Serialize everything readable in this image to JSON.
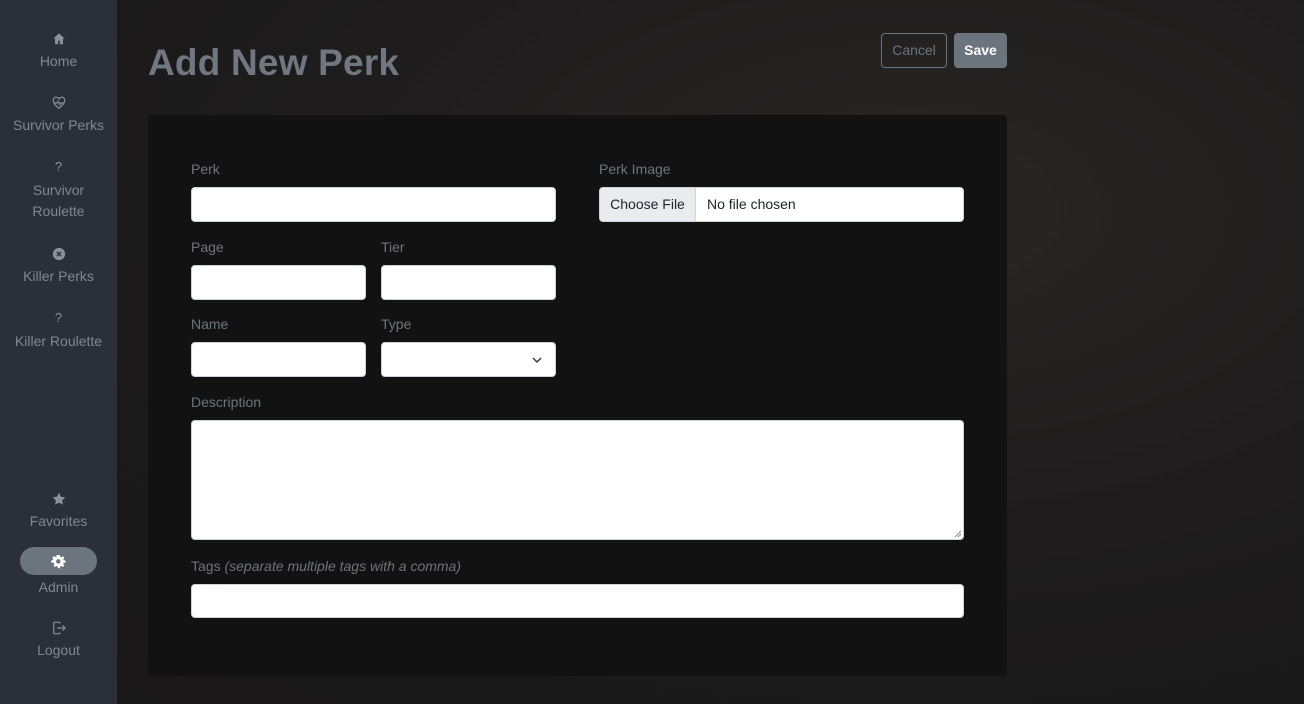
{
  "sidebar": {
    "items": [
      {
        "label": "Home",
        "icon": "home-icon"
      },
      {
        "label": "Survivor Perks",
        "icon": "heart-pulse-icon"
      },
      {
        "label": "Survivor Roulette",
        "icon": "question-icon",
        "glyph": "?"
      },
      {
        "label": "Killer Perks",
        "icon": "x-circle-icon"
      },
      {
        "label": "Killer Roulette",
        "icon": "question-icon",
        "glyph": "?"
      },
      {
        "label": "Favorites",
        "icon": "star-icon"
      },
      {
        "label": "Admin",
        "icon": "gear-icon"
      },
      {
        "label": "Logout",
        "icon": "logout-icon"
      }
    ],
    "active": "Admin",
    "colors": {
      "background": "#2b3038",
      "active_pill": "#6c757d"
    }
  },
  "header": {
    "title": "Add New Perk",
    "cancel_label": "Cancel",
    "save_label": "Save"
  },
  "form": {
    "perk_label": "Perk",
    "perk_value": "",
    "perk_image_label": "Perk Image",
    "file_button_label": "Choose File",
    "file_status": "No file chosen",
    "page_label": "Page",
    "page_value": "",
    "tier_label": "Tier",
    "tier_value": "",
    "name_label": "Name",
    "name_value": "",
    "type_label": "Type",
    "type_value": "",
    "description_label": "Description",
    "description_value": "",
    "tags_label": "Tags",
    "tags_hint": "(separate multiple tags with a comma)",
    "tags_value": ""
  }
}
